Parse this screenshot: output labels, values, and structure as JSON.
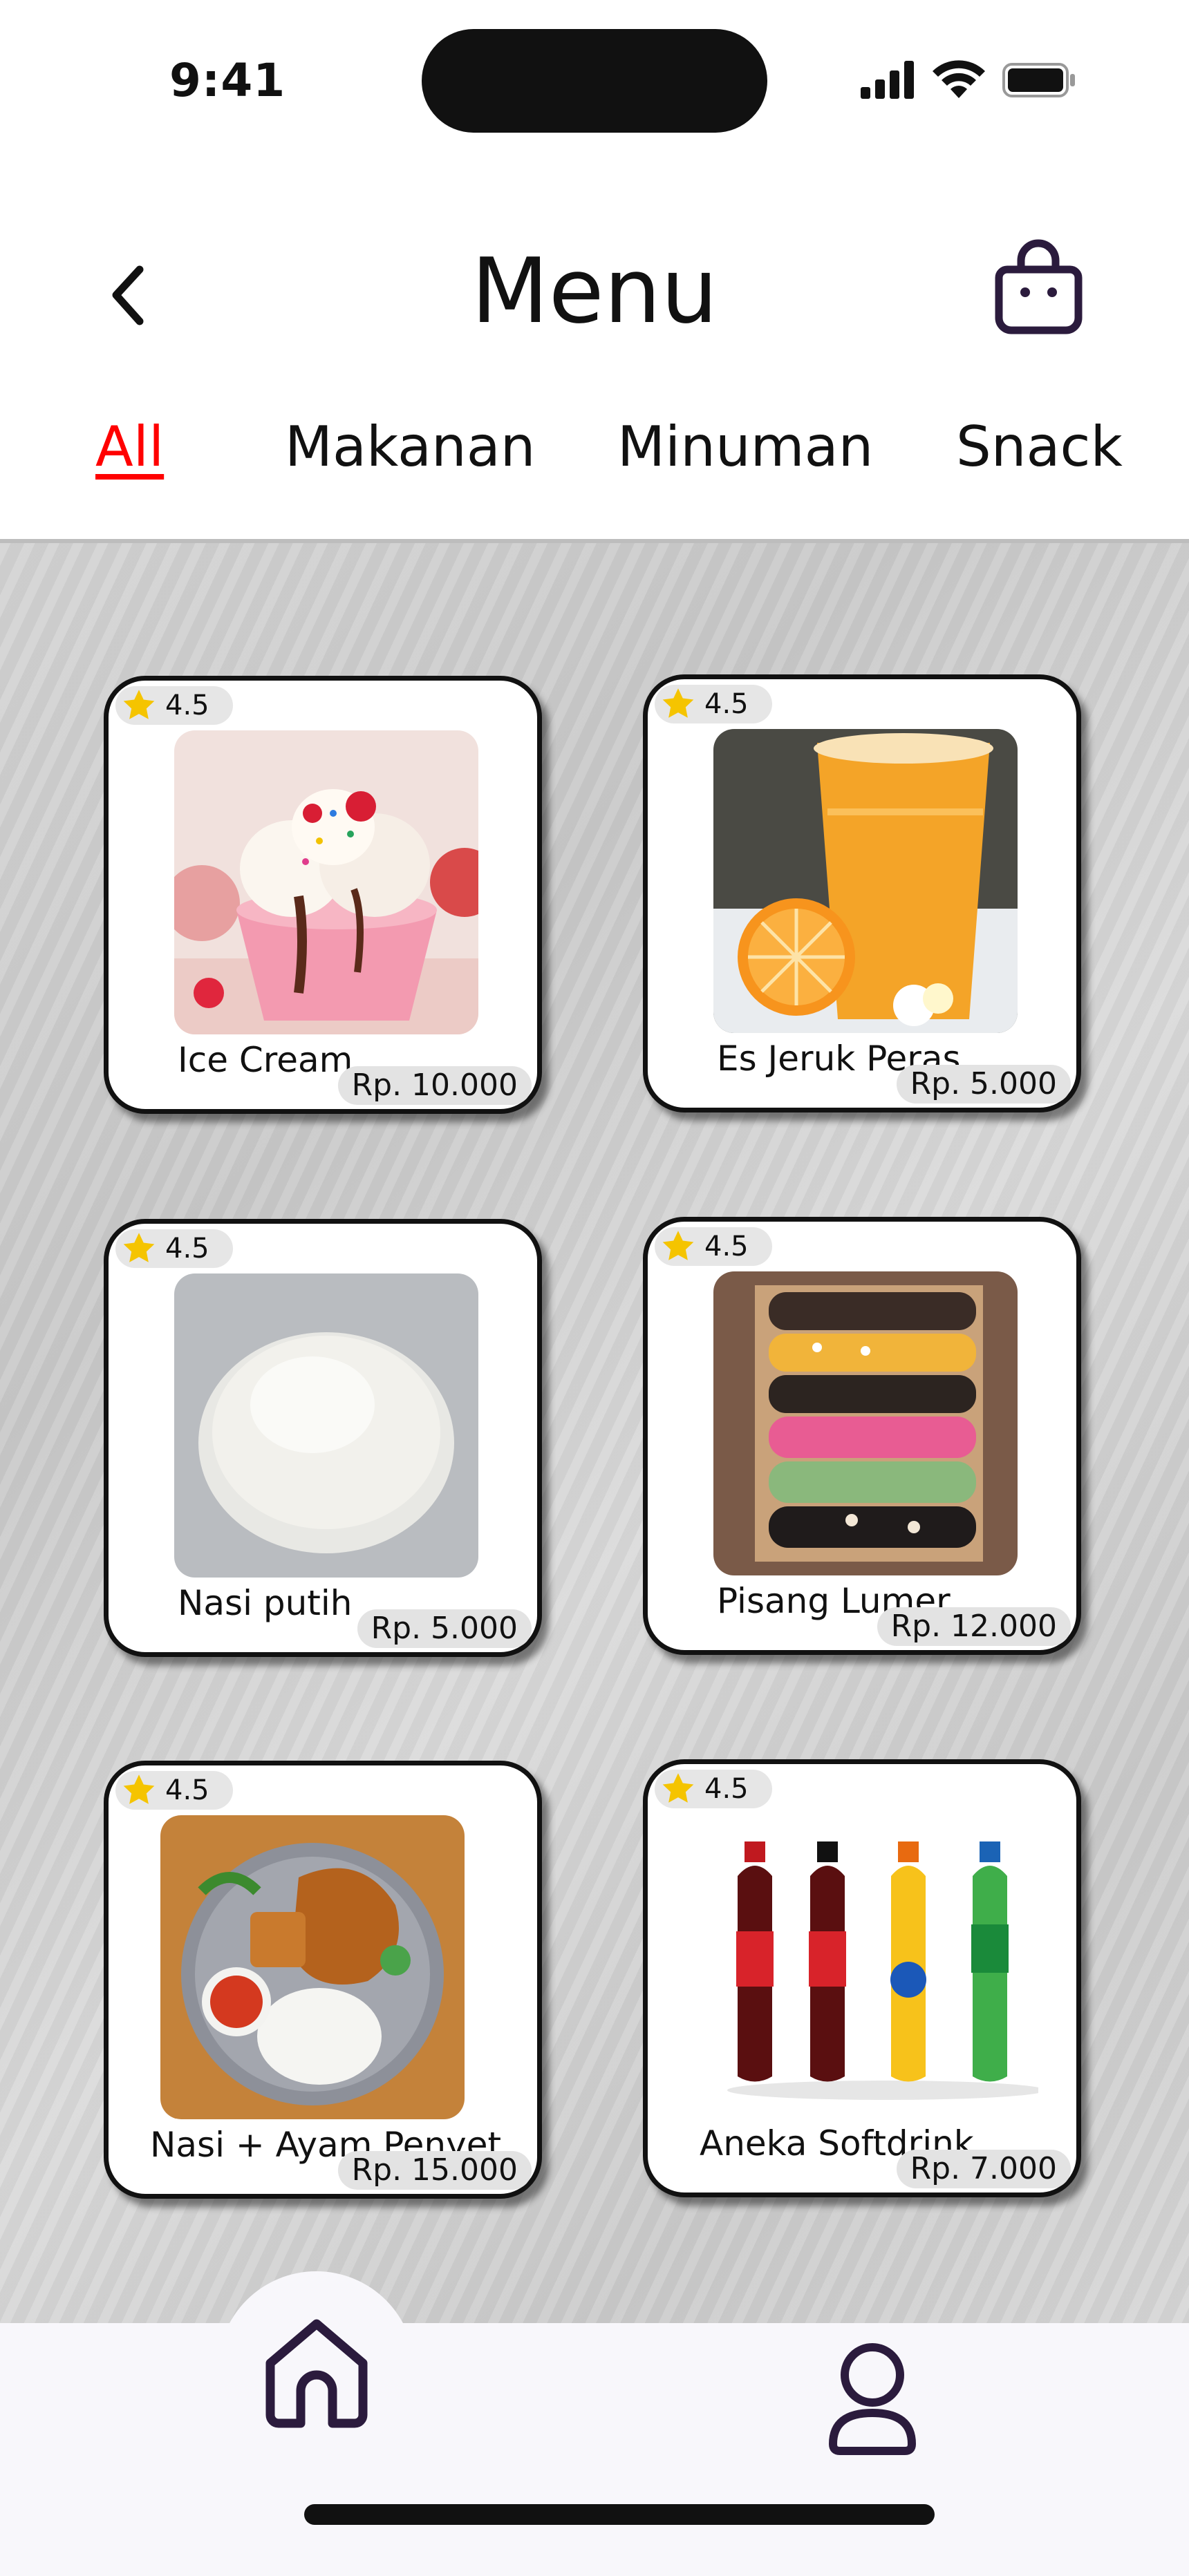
{
  "status_bar": {
    "time": "9:41"
  },
  "header": {
    "title": "Menu",
    "back_icon": "chevron-left-icon",
    "cart_icon": "shopping-bag-icon"
  },
  "tabs": [
    {
      "label": "All",
      "active": true
    },
    {
      "label": "Makanan",
      "active": false
    },
    {
      "label": "Minuman",
      "active": false
    },
    {
      "label": "Snack",
      "active": false
    }
  ],
  "accent_color": "#ff0000",
  "items": [
    {
      "name": "Ice Cream",
      "price": "Rp. 10.000",
      "rating": "4.5",
      "image": "ice-cream-image"
    },
    {
      "name": "Es Jeruk Peras",
      "price": "Rp. 5.000",
      "rating": "4.5",
      "image": "orange-juice-image"
    },
    {
      "name": "Nasi putih",
      "price": "Rp. 5.000",
      "rating": "4.5",
      "image": "white-rice-image"
    },
    {
      "name": "Pisang Lumer",
      "price": "Rp. 12.000",
      "rating": "4.5",
      "image": "banana-dessert-image"
    },
    {
      "name": "Nasi + Ayam Penyet",
      "price": "Rp. 15.000",
      "rating": "4.5",
      "image": "fried-chicken-rice-image"
    },
    {
      "name": "Aneka Softdrink",
      "price": "Rp. 7.000",
      "rating": "4.5",
      "image": "softdrink-bottles-image"
    }
  ],
  "bottom_nav": {
    "home_icon": "home-icon",
    "profile_icon": "user-icon"
  }
}
